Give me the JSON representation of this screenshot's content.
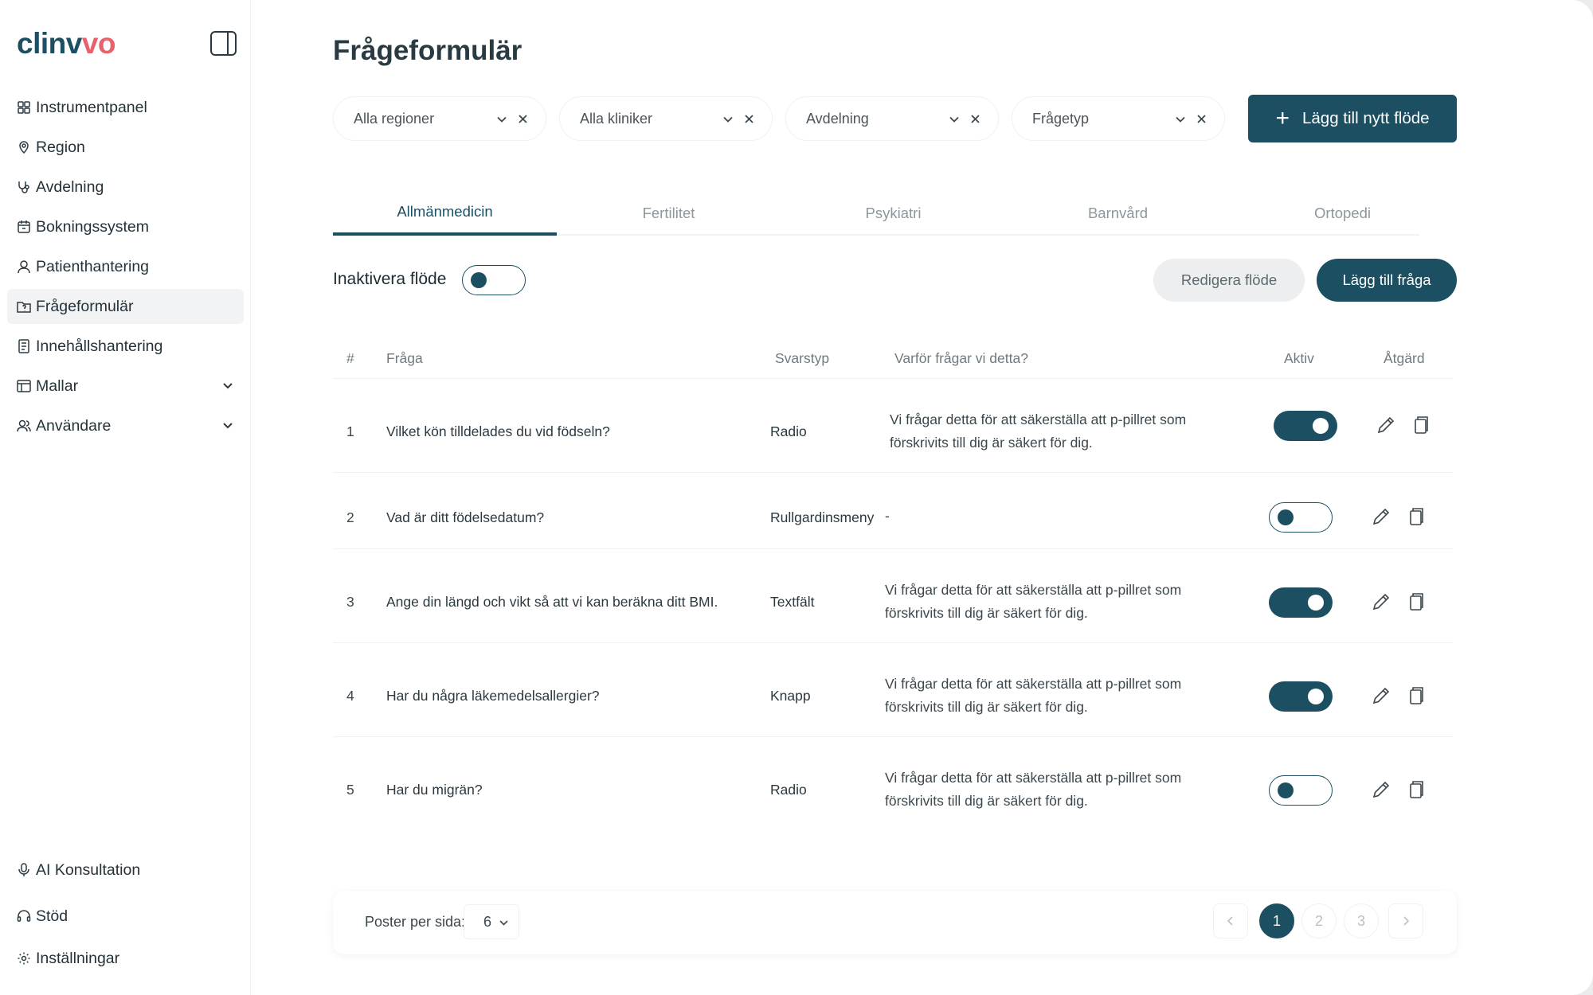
{
  "brand": {
    "logo_main": "clinv",
    "logo_accent": "vo"
  },
  "sidebar": {
    "items": [
      {
        "label": "Instrumentpanel",
        "icon": "dashboard-icon"
      },
      {
        "label": "Region",
        "icon": "map-pin-icon"
      },
      {
        "label": "Avdelning",
        "icon": "stethoscope-icon"
      },
      {
        "label": "Bokningssystem",
        "icon": "calendar-icon"
      },
      {
        "label": "Patienthantering",
        "icon": "user-icon"
      },
      {
        "label": "Frågeformulär",
        "icon": "folder-question-icon",
        "active": true
      },
      {
        "label": "Innehållshantering",
        "icon": "document-icon"
      },
      {
        "label": "Mallar",
        "icon": "template-icon",
        "expandable": true
      },
      {
        "label": "Användare",
        "icon": "users-icon",
        "expandable": true
      }
    ],
    "bottom_items": [
      {
        "label": "AI Konsultation",
        "icon": "microphone-icon"
      },
      {
        "label": "Stöd",
        "icon": "headset-icon"
      },
      {
        "label": "Inställningar",
        "icon": "settings-icon"
      }
    ]
  },
  "page": {
    "title": "Frågeformulär"
  },
  "filters": [
    {
      "label": "Alla regioner"
    },
    {
      "label": "Alla kliniker"
    },
    {
      "label": "Avdelning"
    },
    {
      "label": "Frågetyp"
    }
  ],
  "add_flow_button": {
    "plus": "+",
    "label": "Lägg till nytt flöde"
  },
  "tabs": [
    {
      "label": "Allmänmedicin",
      "active": true
    },
    {
      "label": "Fertilitet"
    },
    {
      "label": "Psykiatri"
    },
    {
      "label": "Barnvård"
    },
    {
      "label": "Ortopedi"
    }
  ],
  "flow_controls": {
    "deactivate_label": "Inaktivera flöde",
    "deactivate_on": false,
    "edit_flow_label": "Redigera flöde",
    "add_question_label": "Lägg till fråga"
  },
  "table": {
    "headers": {
      "num": "#",
      "question": "Fråga",
      "answer_type": "Svarstyp",
      "why": "Varför frågar vi detta?",
      "active": "Aktiv",
      "action": "Åtgärd"
    },
    "rows": [
      {
        "num": "1",
        "question": "Vilket kön tilldelades du vid födseln?",
        "answer_type": "Radio",
        "why_line1": "Vi frågar detta för att säkerställa att p-pillret som",
        "why_line2": "förskrivits till dig är säkert för dig.",
        "active": true
      },
      {
        "num": "2",
        "question": "Vad är ditt födelsedatum?",
        "answer_type": "Rullgardinsmeny",
        "why_line1": "-",
        "why_line2": "",
        "active": false
      },
      {
        "num": "3",
        "question": "Ange din längd och vikt så att vi kan beräkna ditt BMI.",
        "answer_type": "Textfält",
        "why_line1": "Vi frågar detta för att säkerställa att p-pillret som",
        "why_line2": "förskrivits till dig är säkert för dig.",
        "active": true
      },
      {
        "num": "4",
        "question": "Har du några läkemedelsallergier?",
        "answer_type": "Knapp",
        "why_line1": "Vi frågar detta för att säkerställa att p-pillret som",
        "why_line2": "förskrivits till dig är säkert för dig.",
        "active": true
      },
      {
        "num": "5",
        "question": "Har du migrän?",
        "answer_type": "Radio",
        "why_line1": "Vi frågar detta för att säkerställa att p-pillret som",
        "why_line2": "förskrivits till dig är säkert för dig.",
        "active": false
      }
    ]
  },
  "pagination": {
    "per_page_label": "Poster per sida:",
    "per_page_value": "6",
    "pages": [
      "1",
      "2",
      "3"
    ],
    "current_page": "1"
  },
  "colors": {
    "primary": "#1d4f63",
    "accent": "#e8626b"
  }
}
